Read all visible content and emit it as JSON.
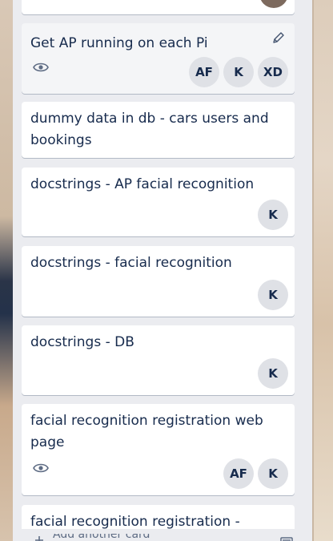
{
  "board_colors": {
    "list_bg": "#ebecf0",
    "card_bg": "#ffffff",
    "text": "#172b4d",
    "avatar_bg": "#dfe1e6"
  },
  "cards": [
    {
      "title": "",
      "members": [
        {
          "initials": ""
        }
      ],
      "partial": "top"
    },
    {
      "title": "Get AP running on each Pi",
      "watch": true,
      "editing": true,
      "members": [
        {
          "initials": "AF"
        },
        {
          "initials": "K"
        },
        {
          "initials": "XD"
        }
      ]
    },
    {
      "title": "dummy data in db - cars users and bookings",
      "members": []
    },
    {
      "title": "docstrings - AP facial recognition",
      "members": [
        {
          "initials": "K"
        }
      ]
    },
    {
      "title": "docstrings - facial recognition",
      "members": [
        {
          "initials": "K"
        }
      ]
    },
    {
      "title": "docstrings - DB",
      "members": [
        {
          "initials": "K"
        }
      ]
    },
    {
      "title": "facial recognition registration web page",
      "watch": true,
      "members": [
        {
          "initials": "AF"
        },
        {
          "initials": "K"
        }
      ]
    },
    {
      "title": "facial recognition registration -",
      "members": [],
      "partial": "bottom"
    }
  ],
  "footer": {
    "add_card_label": "Add another card",
    "icons": [
      "plus-icon",
      "template-icon"
    ]
  },
  "icons": {
    "watch": "eye-icon",
    "edit": "pencil-icon"
  }
}
